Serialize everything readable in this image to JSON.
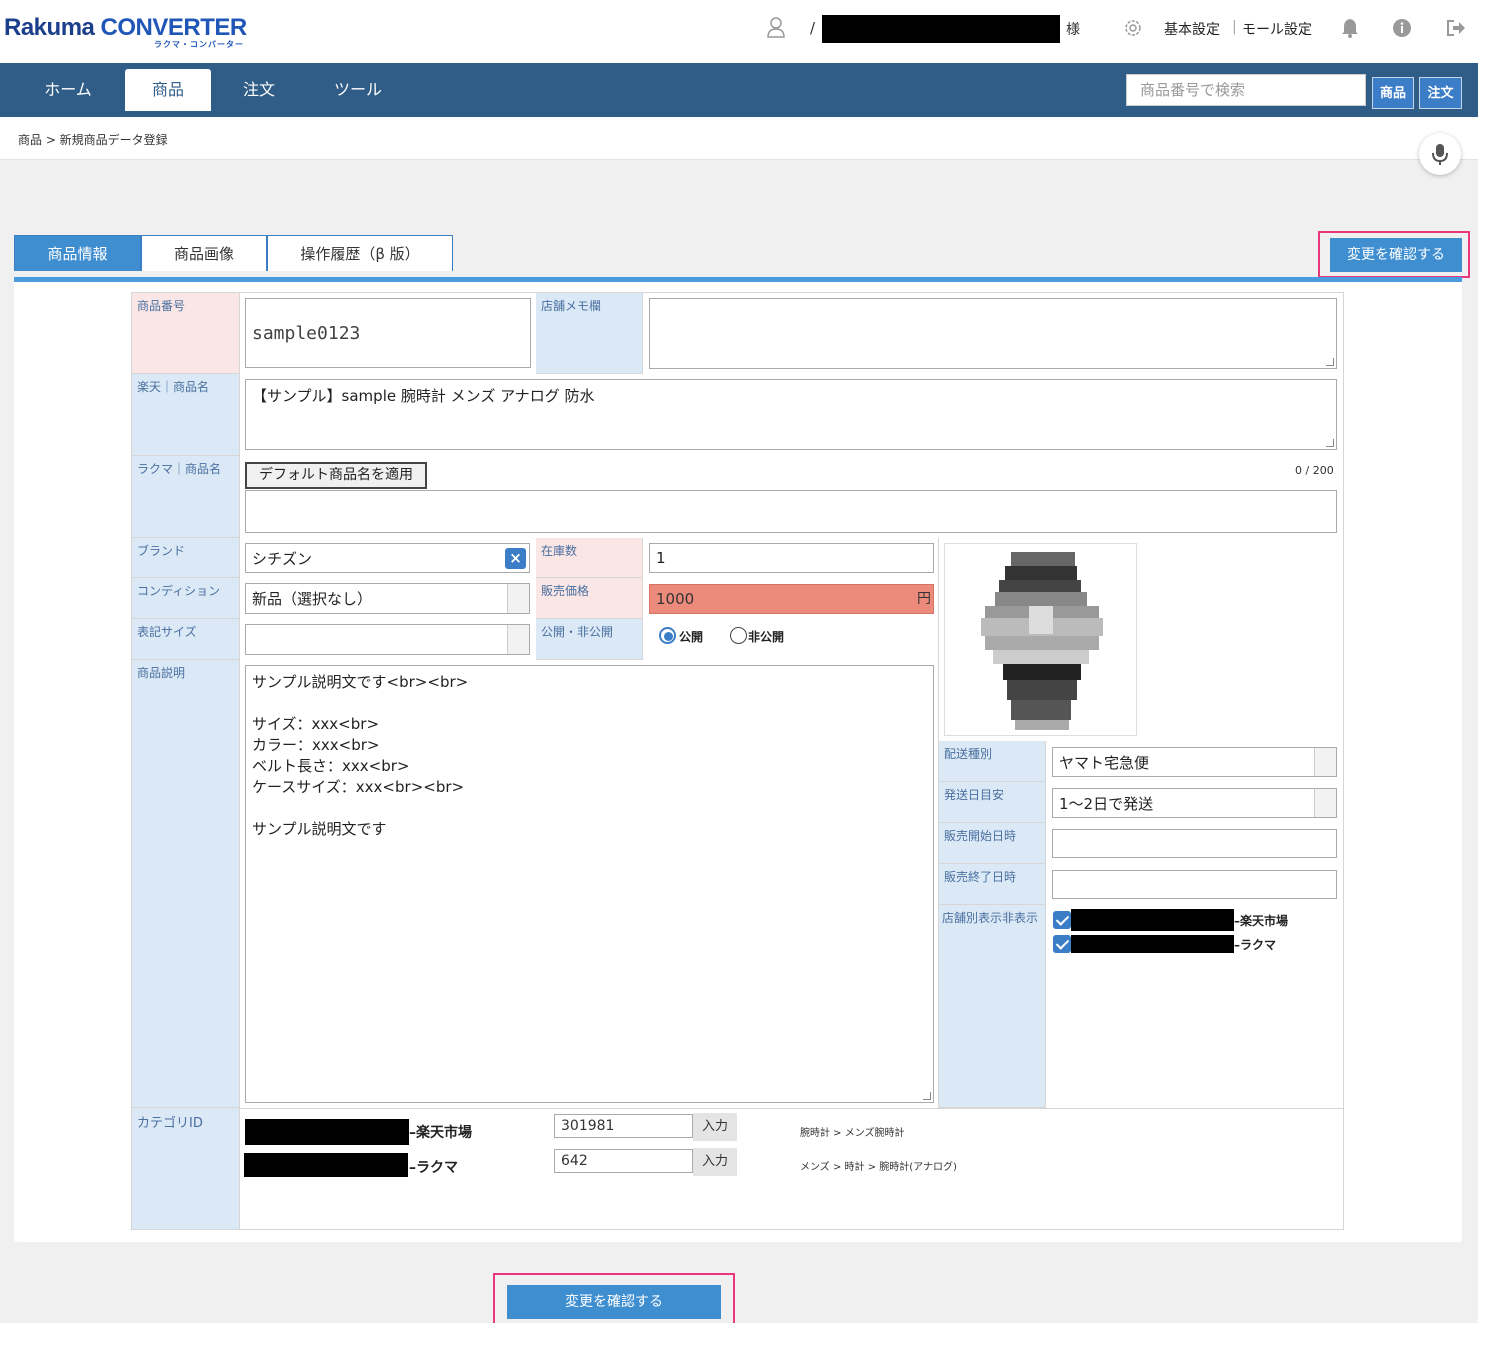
{
  "header": {
    "logo_main_a": "Rakuma ",
    "logo_main_b": "CONVERTER",
    "logo_sub": "ラクマ・コンバーター",
    "user_slash": "/",
    "user_suffix": "様",
    "basic_settings": "基本設定",
    "separator": "|",
    "mall_settings": "モール設定"
  },
  "nav": {
    "items": [
      {
        "label": "ホーム"
      },
      {
        "label": "商品"
      },
      {
        "label": "注文"
      },
      {
        "label": "ツール"
      }
    ],
    "search_placeholder": "商品番号で検索",
    "search_product": "商品",
    "search_order": "注文"
  },
  "breadcrumb": "商品 > 新規商品データ登録",
  "tabs": [
    {
      "label": "商品情報"
    },
    {
      "label": "商品画像"
    },
    {
      "label": "操作履歴（β 版）"
    }
  ],
  "confirm_label": "変更を確認する",
  "form": {
    "item_number_label": "商品番号",
    "item_number_value": "sample0123",
    "memo_label": "店舗メモ欄",
    "memo_value": "",
    "rakuten_name_label": "楽天｜商品名",
    "rakuten_name_value": "【サンプル】sample 腕時計 メンズ アナログ 防水",
    "rakuma_name_label": "ラクマ｜商品名",
    "apply_default_name": "デフォルト商品名を適用",
    "char_counter": "0 / 200",
    "brand_label": "ブランド",
    "brand_value": "シチズン",
    "clear_symbol": "×",
    "stock_label": "在庫数",
    "stock_value": "1",
    "condition_label": "コンディション",
    "condition_value": "新品（選択なし）",
    "price_label": "販売価格",
    "price_value": "1000",
    "price_unit": "円",
    "size_label": "表記サイズ",
    "size_value": "",
    "visibility_label": "公開・非公開",
    "visibility_public": "公開",
    "visibility_private": "非公開",
    "visibility_selected": "public",
    "description_label": "商品説明",
    "description_value": "サンプル説明文です<br><br>\n\nサイズ：xxx<br>\nカラー：xxx<br>\nベルト長さ：xxx<br>\nケースサイズ：xxx<br><br>\n\nサンプル説明文です",
    "shipping_type_label": "配送種別",
    "shipping_type_value": "ヤマト宅急便",
    "ship_days_label": "発送日目安",
    "ship_days_value": "1〜2日で発送",
    "sale_start_label": "販売開始日時",
    "sale_end_label": "販売終了日時",
    "store_display_label": "店舗別表示非表示",
    "stores": [
      {
        "suffix": "–楽天市場",
        "checked": true
      },
      {
        "suffix": "–ラクマ",
        "checked": true
      }
    ],
    "category_label": "カテゴリID",
    "categories": [
      {
        "mall": "–楽天市場",
        "id": "301981",
        "button": "入力",
        "path": "腕時計 > メンズ腕時計"
      },
      {
        "mall": "–ラクマ",
        "id": "642",
        "button": "入力",
        "path": "メンズ > 時計 > 腕時計(アナログ)"
      }
    ]
  },
  "colors": {
    "nav_bg": "#2f5d87",
    "accent": "#3e8ed0",
    "highlight": "#e8387b",
    "price_bg": "#ec8a7c"
  }
}
